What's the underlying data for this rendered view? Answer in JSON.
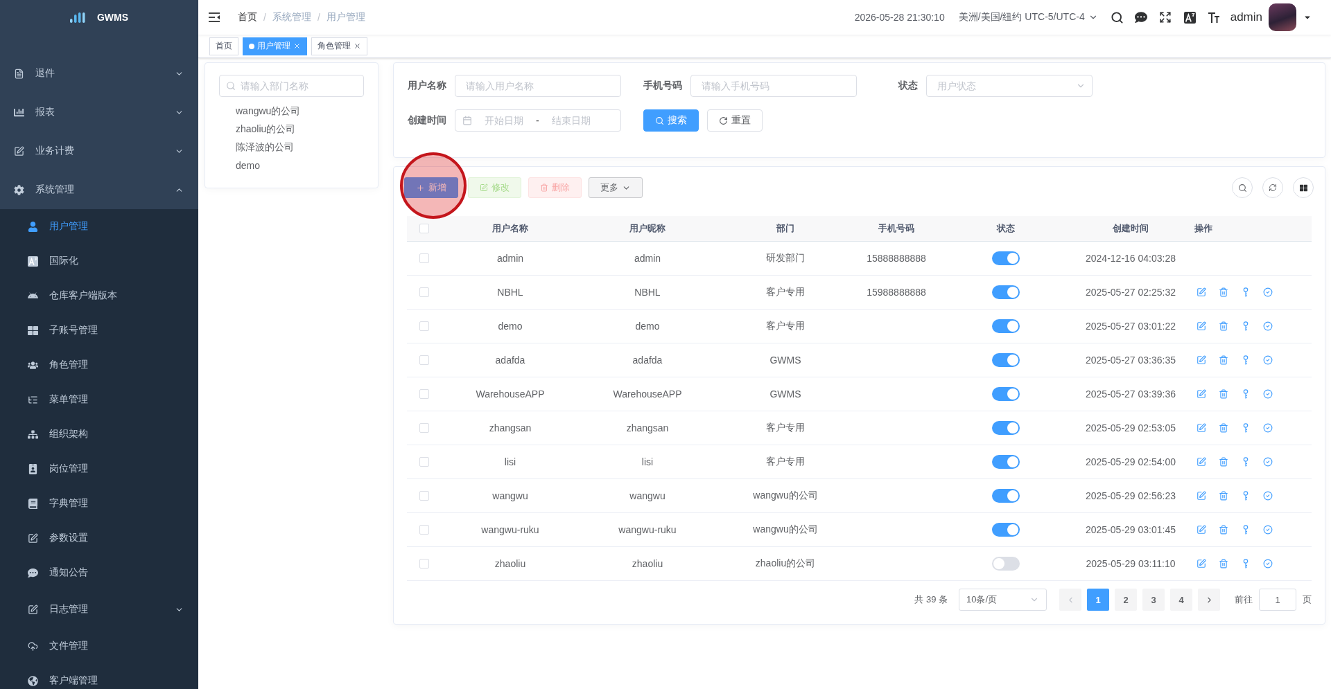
{
  "sidebar": {
    "logo_text": "GWMS",
    "items": [
      {
        "label": "退件",
        "expanded": false
      },
      {
        "label": "报表",
        "expanded": false
      },
      {
        "label": "业务计费",
        "expanded": false
      },
      {
        "label": "系统管理",
        "expanded": true,
        "children": [
          {
            "kind": "item",
            "label": "用户管理",
            "selected": true
          },
          {
            "kind": "item",
            "label": "国际化",
            "selected": false
          },
          {
            "kind": "item",
            "label": "仓库客户端版本",
            "selected": false
          },
          {
            "kind": "item",
            "label": "子账号管理",
            "selected": false
          },
          {
            "kind": "item",
            "label": "角色管理",
            "selected": false
          },
          {
            "kind": "item",
            "label": "菜单管理",
            "selected": false
          },
          {
            "kind": "item",
            "label": "组织架构",
            "selected": false
          },
          {
            "kind": "item",
            "label": "岗位管理",
            "selected": false
          },
          {
            "kind": "item",
            "label": "字典管理",
            "selected": false
          },
          {
            "kind": "item",
            "label": "参数设置",
            "selected": false
          },
          {
            "kind": "item",
            "label": "通知公告",
            "selected": false
          },
          {
            "kind": "group",
            "label": "日志管理",
            "expanded": false
          },
          {
            "kind": "item",
            "label": "文件管理",
            "selected": false
          },
          {
            "kind": "item",
            "label": "客户端管理",
            "selected": false
          }
        ]
      }
    ]
  },
  "navbar": {
    "breadcrumb": {
      "separator": "/",
      "items": [
        {
          "label": "首页",
          "link": true
        },
        {
          "label": "系统管理",
          "link": false
        },
        {
          "label": "用户管理",
          "link": false
        }
      ]
    },
    "datetime": "2026-05-28 21:30:10",
    "timezone": "美洲/美国/纽约 UTC-5/UTC-4",
    "username": "admin"
  },
  "tags_view": [
    {
      "label": "首页",
      "selected": false,
      "closable": false
    },
    {
      "label": "用户管理",
      "selected": true,
      "closable": true
    },
    {
      "label": "角色管理",
      "selected": false,
      "closable": true
    }
  ],
  "dept_panel": {
    "search_placeholder": "请输入部门名称",
    "nodes": [
      {
        "label": "wangwu的公司",
        "selected": false
      },
      {
        "label": "zhaoliu的公司",
        "selected": false
      },
      {
        "label": "陈泽波的公司",
        "selected": false
      },
      {
        "label": "demo",
        "selected": false
      }
    ]
  },
  "search_form": {
    "fields": [
      {
        "kind": "input",
        "label": "用户名称",
        "placeholder": "请输入用户名称"
      },
      {
        "kind": "input",
        "label": "手机号码",
        "placeholder": "请输入手机号码"
      },
      {
        "kind": "select",
        "label": "状态",
        "placeholder": "用户状态"
      },
      {
        "kind": "daterange",
        "label": "创建时间",
        "start_placeholder": "开始日期",
        "separator": "-",
        "end_placeholder": "结束日期"
      }
    ],
    "buttons": [
      {
        "kind": "primary",
        "label": "搜索"
      },
      {
        "kind": "default",
        "label": "重置"
      }
    ]
  },
  "table_toolbar": {
    "buttons": [
      {
        "kind": "primary",
        "label": "新增",
        "disabled": false,
        "highlighted": true
      },
      {
        "kind": "success",
        "label": "修改",
        "disabled": true,
        "highlighted": false
      },
      {
        "kind": "danger",
        "label": "删除",
        "disabled": true,
        "highlighted": false
      },
      {
        "kind": "more",
        "label": "更多",
        "disabled": false,
        "highlighted": false
      }
    ]
  },
  "table": {
    "header_checked": false,
    "columns": [
      "用户名称",
      "用户昵称",
      "部门",
      "手机号码",
      "状态",
      "创建时间",
      "操作"
    ],
    "rows": [
      {
        "checked": false,
        "username": "admin",
        "nickname": "admin",
        "dept": "研发部门",
        "phone": "15888888888",
        "status_on": true,
        "created": "2024-12-16 04:03:28",
        "has_actions": false
      },
      {
        "checked": false,
        "username": "NBHL",
        "nickname": "NBHL",
        "dept": "客户专用",
        "phone": "15988888888",
        "status_on": true,
        "created": "2025-05-27 02:25:32",
        "has_actions": true
      },
      {
        "checked": false,
        "username": "demo",
        "nickname": "demo",
        "dept": "客户专用",
        "status_on": true,
        "created": "2025-05-27 03:01:22",
        "has_actions": true
      },
      {
        "checked": false,
        "username": "adafda",
        "nickname": "adafda",
        "dept": "GWMS",
        "status_on": true,
        "created": "2025-05-27 03:36:35",
        "has_actions": true
      },
      {
        "checked": false,
        "username": "WarehouseAPP",
        "nickname": "WarehouseAPP",
        "dept": "GWMS",
        "status_on": true,
        "created": "2025-05-27 03:39:36",
        "has_actions": true
      },
      {
        "checked": false,
        "username": "zhangsan",
        "nickname": "zhangsan",
        "dept": "客户专用",
        "status_on": true,
        "created": "2025-05-29 02:53:05",
        "has_actions": true
      },
      {
        "checked": false,
        "username": "lisi",
        "nickname": "lisi",
        "dept": "客户专用",
        "status_on": true,
        "created": "2025-05-29 02:54:00",
        "has_actions": true
      },
      {
        "checked": false,
        "username": "wangwu",
        "nickname": "wangwu",
        "dept": "wangwu的公司",
        "status_on": true,
        "created": "2025-05-29 02:56:23",
        "has_actions": true
      },
      {
        "checked": false,
        "username": "wangwu-ruku",
        "nickname": "wangwu-ruku",
        "dept": "wangwu的公司",
        "status_on": true,
        "created": "2025-05-29 03:01:45",
        "has_actions": true
      },
      {
        "checked": false,
        "username": "zhaoliu",
        "nickname": "zhaoliu",
        "dept": "zhaoliu的公司",
        "status_on": false,
        "created": "2025-05-29 03:11:10",
        "has_actions": true
      }
    ]
  },
  "pagination": {
    "total": "共 39 条",
    "page_size": "10条/页",
    "prev_disabled": true,
    "next_disabled": false,
    "pages": [
      {
        "label": "1",
        "selected": true
      },
      {
        "label": "2",
        "selected": false
      },
      {
        "label": "3",
        "selected": false
      },
      {
        "label": "4",
        "selected": false
      }
    ],
    "goto_label": "前往",
    "goto_value": "1",
    "page_unit": "页"
  }
}
